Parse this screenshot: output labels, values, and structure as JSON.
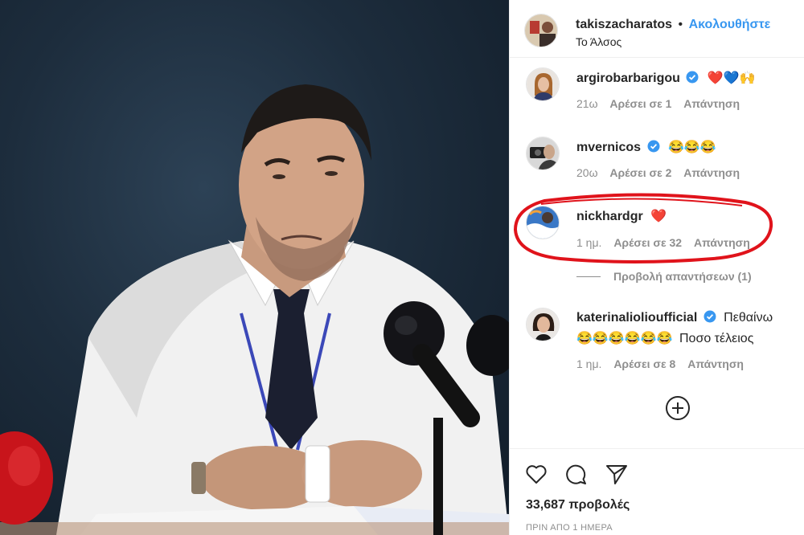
{
  "post": {
    "username": "takiszacharatos",
    "separator": "•",
    "follow_label": "Ακολουθήστε",
    "location": "Το Άλσος"
  },
  "comments": [
    {
      "username": "argirobarbarigou",
      "verified": true,
      "text": "❤️💙🙌",
      "time": "21ω",
      "likes": "Αρέσει σε 1",
      "reply": "Απάντηση"
    },
    {
      "username": "mvernicos",
      "verified": true,
      "text": "😂😂😂",
      "time": "20ω",
      "likes": "Αρέσει σε 2",
      "reply": "Απάντηση"
    },
    {
      "username": "nickhardgr",
      "verified": false,
      "text": "❤️",
      "time": "1 ημ.",
      "likes": "Αρέσει σε 32",
      "reply": "Απάντηση"
    },
    {
      "username": "katerinaliolioufficial",
      "verified": true,
      "text": "Πεθαίνω",
      "text2_emoji": "😂😂😂😂😂😂",
      "text2": "Ποσο τέλειος",
      "time": "1 ημ.",
      "likes": "Αρέσει σε 8",
      "reply": "Απάντηση"
    }
  ],
  "view_replies": "Προβολή απαντήσεων (1)",
  "footer": {
    "views": "33,687 προβολές",
    "time_ago": "ΠΡΙΝ ΑΠΟ 1 ΗΜΕΡΑ"
  },
  "icons": {
    "like": "heart-icon",
    "comment": "comment-icon",
    "share": "share-icon",
    "load_more": "plus-circle-icon",
    "verified": "verified-badge-icon"
  },
  "colors": {
    "link_blue": "#3897f0",
    "muted": "#8e8e8e",
    "text": "#262626",
    "highlight_red": "#e0131b"
  }
}
